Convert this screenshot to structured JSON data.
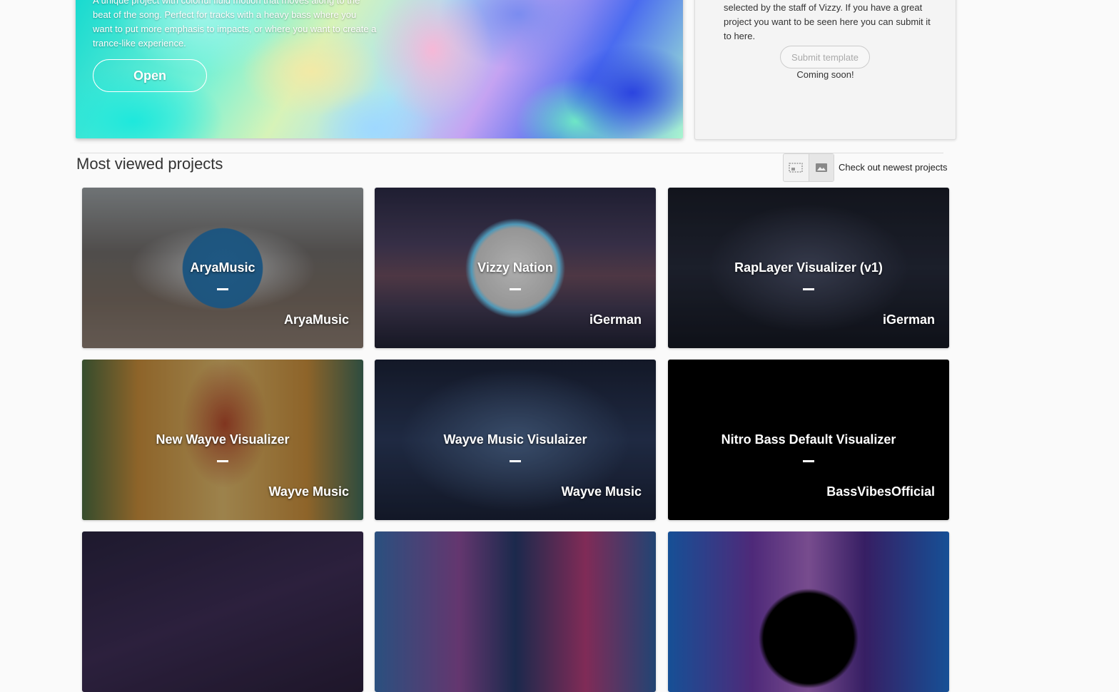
{
  "featured": {
    "description": "A unique project with colorful fluid motion that moves along to the beat of the song. Perfect for tracks with a heavy bass where you want to put more emphasis to impacts, or where you want to create a trance-like experience.",
    "open_label": "Open"
  },
  "side_card": {
    "text": "selected by the staff of Vizzy. If you have a great project you want to be seen here you can submit it to here.",
    "submit_label": "Submit template",
    "coming_soon": "Coming soon!"
  },
  "section": {
    "title": "Most viewed projects",
    "newest_link": "Check out newest projects",
    "view_icons": [
      "grid-view-icon",
      "image-view-icon"
    ]
  },
  "projects": [
    {
      "title": "AryaMusic",
      "author": "AryaMusic"
    },
    {
      "title": "Vizzy Nation",
      "author": "iGerman"
    },
    {
      "title": "RapLayer Visualizer (v1)",
      "author": "iGerman"
    },
    {
      "title": "New Wayve Visualizer",
      "author": "Wayve Music"
    },
    {
      "title": "Wayve Music Visulaizer",
      "author": "Wayve Music"
    },
    {
      "title": "Nitro Bass Default Visualizer",
      "author": "BassVibesOfficial"
    },
    {
      "title": "",
      "author": ""
    },
    {
      "title": "",
      "author": ""
    },
    {
      "title": "",
      "author": ""
    }
  ]
}
